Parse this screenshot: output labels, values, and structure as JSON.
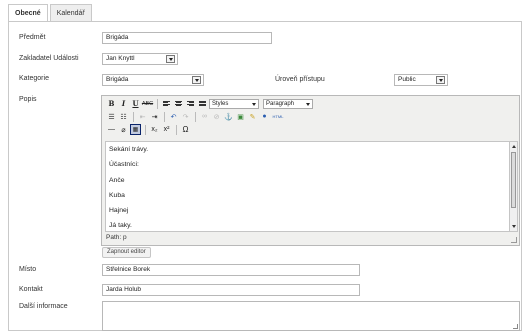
{
  "tabs": [
    {
      "label": "Obecné",
      "active": true
    },
    {
      "label": "Kalendář",
      "active": false
    }
  ],
  "form": {
    "predmet": {
      "label": "Předmět",
      "value": "Brigáda"
    },
    "zakladatel": {
      "label": "Zakladatel Události",
      "value": "Jan Knyttl"
    },
    "kategorie": {
      "label": "Kategorie",
      "value": "Brigáda"
    },
    "uroven": {
      "label": "Úroveň přístupu",
      "value": "Public"
    },
    "popis": {
      "label": "Popis"
    },
    "misto": {
      "label": "Místo",
      "value": "Střelnice Borek"
    },
    "kontakt": {
      "label": "Kontakt",
      "value": "Jarda Holub"
    },
    "dalsi": {
      "label": "Další informace",
      "value": ""
    }
  },
  "editor": {
    "toolbar": {
      "bold": "B",
      "italic": "I",
      "underline": "U",
      "strike": "ABC",
      "styles": "Styles",
      "format": "Paragraph",
      "html": "HTML",
      "subscript": "x₂",
      "superscript": "x²",
      "charmap": "Ω"
    },
    "lines": [
      "Sekání trávy.",
      "Účastníci:",
      "Anče",
      "Kuba",
      "Hajnej",
      "Já taky."
    ],
    "path": "Path: p",
    "toggle_button": "Zapnout editor"
  }
}
